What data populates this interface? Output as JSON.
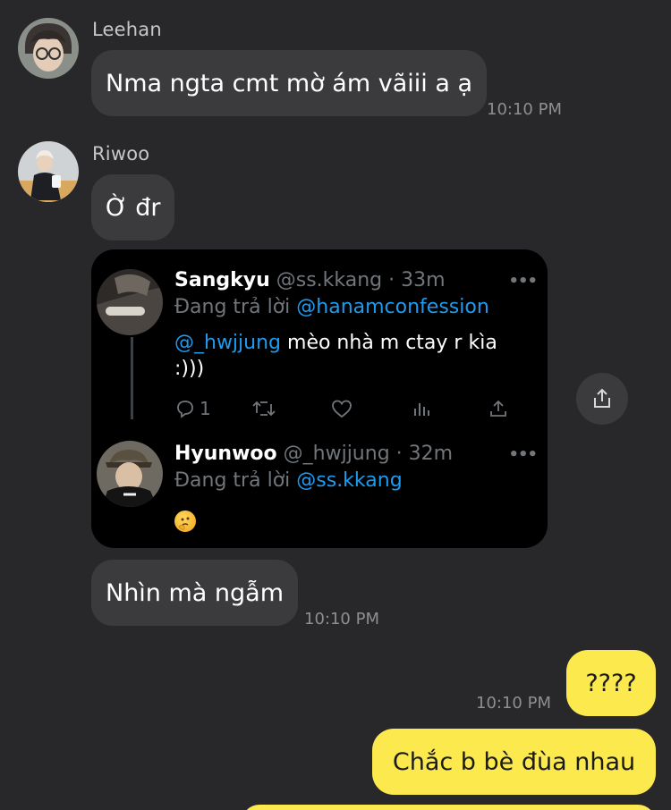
{
  "messages": {
    "leehan": {
      "sender": "Leehan",
      "text": "Nma ngta cmt mờ ám vãiii a ạ",
      "time": "10:10 PM"
    },
    "riwoo": {
      "sender": "Riwoo",
      "text": "Ờ đr"
    },
    "riwoo_followup": {
      "text": "Nhìn mà ngẫm",
      "time": "10:10 PM"
    },
    "mine_1": {
      "text": "????",
      "time": "10:10 PM"
    },
    "mine_2": {
      "text": "Chắc b bè đùa nhau"
    }
  },
  "tweet": {
    "main": {
      "name": "Sangkyu",
      "handle": "@ss.kkang · 33m",
      "reply_prefix": "Đang trả lời ",
      "reply_to": "@hanamconfession",
      "mention": "@_hwjjung",
      "text_rest": " mèo nhà m ctay r kìa :)))",
      "reply_count": "1",
      "more": "•••"
    },
    "reply": {
      "name": "Hyunwoo",
      "handle": "@_hwjjung · 32m",
      "reply_prefix": "Đang trả lời ",
      "reply_to": "@ss.kkang",
      "more": "•••"
    }
  },
  "icons": {
    "reply": "comment-icon",
    "retweet": "retweet-icon",
    "like": "heart-icon",
    "views": "bar-chart-icon",
    "share": "share-icon"
  },
  "colors": {
    "background": "#28282a",
    "bubble_incoming": "#3b3b3e",
    "bubble_outgoing": "#fbe94e",
    "tweet_link": "#1d9bf0"
  }
}
